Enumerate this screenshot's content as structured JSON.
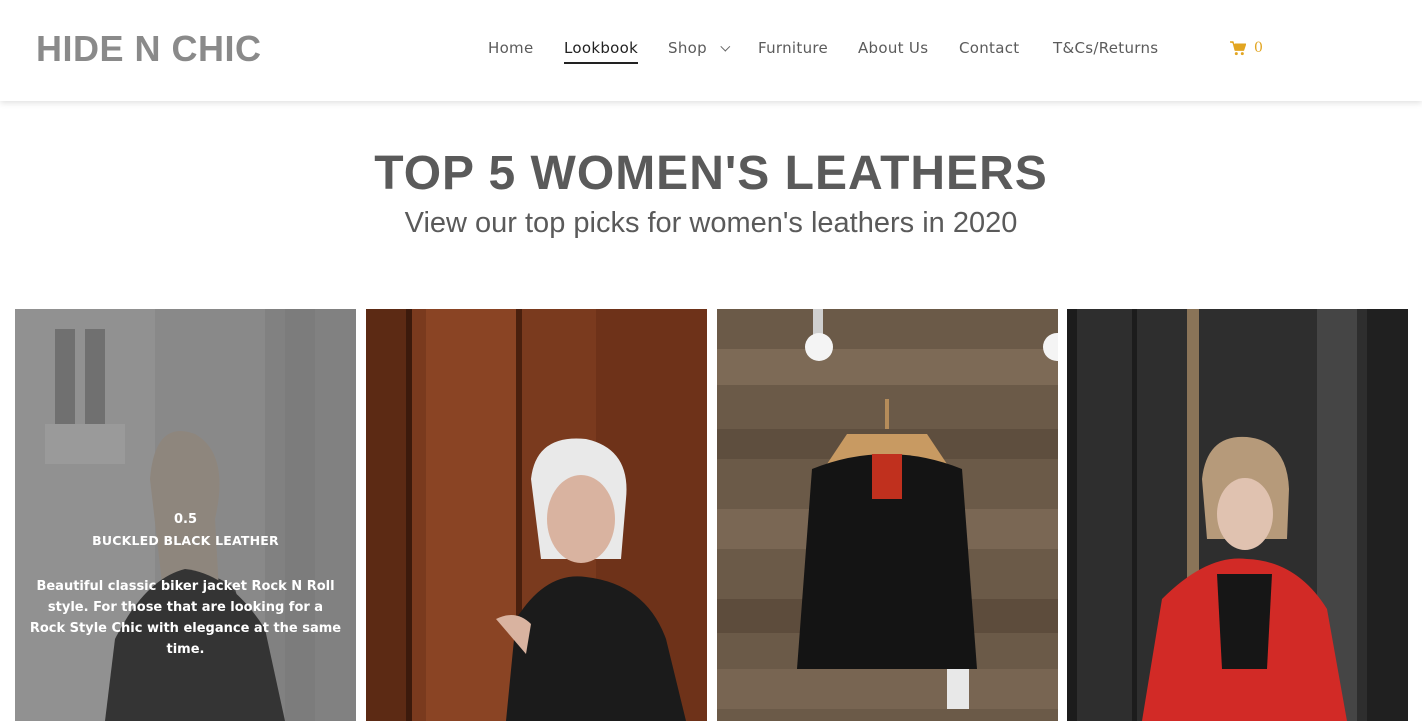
{
  "brand": {
    "logo": "HIDE N CHIC"
  },
  "nav": {
    "items": [
      {
        "label": "Home"
      },
      {
        "label": "Lookbook",
        "active": true
      },
      {
        "label": "Shop",
        "has_dropdown": true
      },
      {
        "label": "Furniture"
      },
      {
        "label": "About Us"
      },
      {
        "label": "Contact"
      },
      {
        "label": "T&Cs/Returns"
      }
    ],
    "cart": {
      "icon": "shopping-cart-icon",
      "count": "0",
      "color": "#e2a521"
    }
  },
  "hero": {
    "title": "TOP 5 WOMEN'S LEATHERS",
    "subtitle": "View our top picks for women's leathers in 2020"
  },
  "products": [
    {
      "image": "woman-in-black-leather-jacket-grey-building",
      "overlay": {
        "rating": "0.5",
        "name": "BUCKLED BLACK LEATHER",
        "description": "Beautiful classic biker jacket Rock N Roll style. For those that are looking for a Rock Style Chic with elegance at the same time."
      }
    },
    {
      "image": "woman-with-white-hair-black-leather-rust-wall"
    },
    {
      "image": "studded-black-leather-jacket-on-hanger-wood-wall"
    },
    {
      "image": "woman-in-red-leather-jacket-dark-wall"
    }
  ]
}
